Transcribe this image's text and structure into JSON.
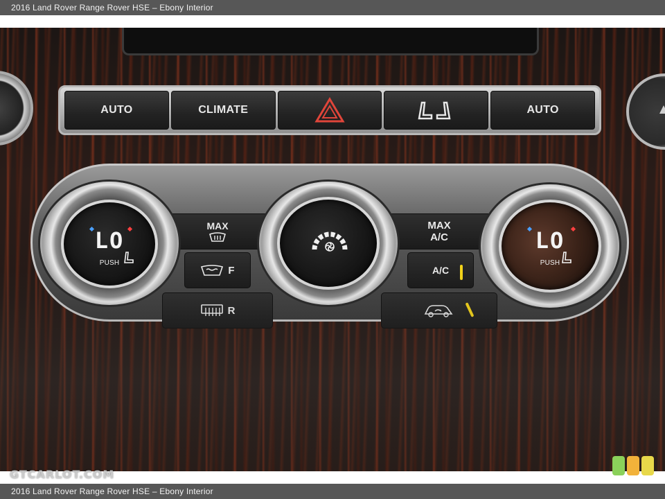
{
  "caption": {
    "top": "2016 Land Rover Range Rover HSE – Ebony Interior",
    "bottom": "2016 Land Rover Range Rover HSE – Ebony Interior"
  },
  "button_strip": {
    "auto_left": "AUTO",
    "climate": "CLIMATE",
    "hazard_icon": "hazard-triangle-icon",
    "seat_icon": "seat-heat-icon",
    "auto_right": "AUTO"
  },
  "left_zone": {
    "temp": "LO",
    "push": "PUSH"
  },
  "right_zone": {
    "temp": "LO",
    "push": "PUSH"
  },
  "center_dial": {
    "icon": "fan-speed-icon"
  },
  "buttons": {
    "max_defrost_line1": "MAX",
    "front_defrost_suffix": "F",
    "rear_defrost_suffix": "R",
    "max_ac_line1": "MAX",
    "max_ac_line2": "A/C",
    "ac": "A/C"
  },
  "colors": {
    "hazard": "#e0453a",
    "indicator": "#f2d21a",
    "wood": "#2a1c18"
  },
  "watermark": "GTCARLOT.COM"
}
